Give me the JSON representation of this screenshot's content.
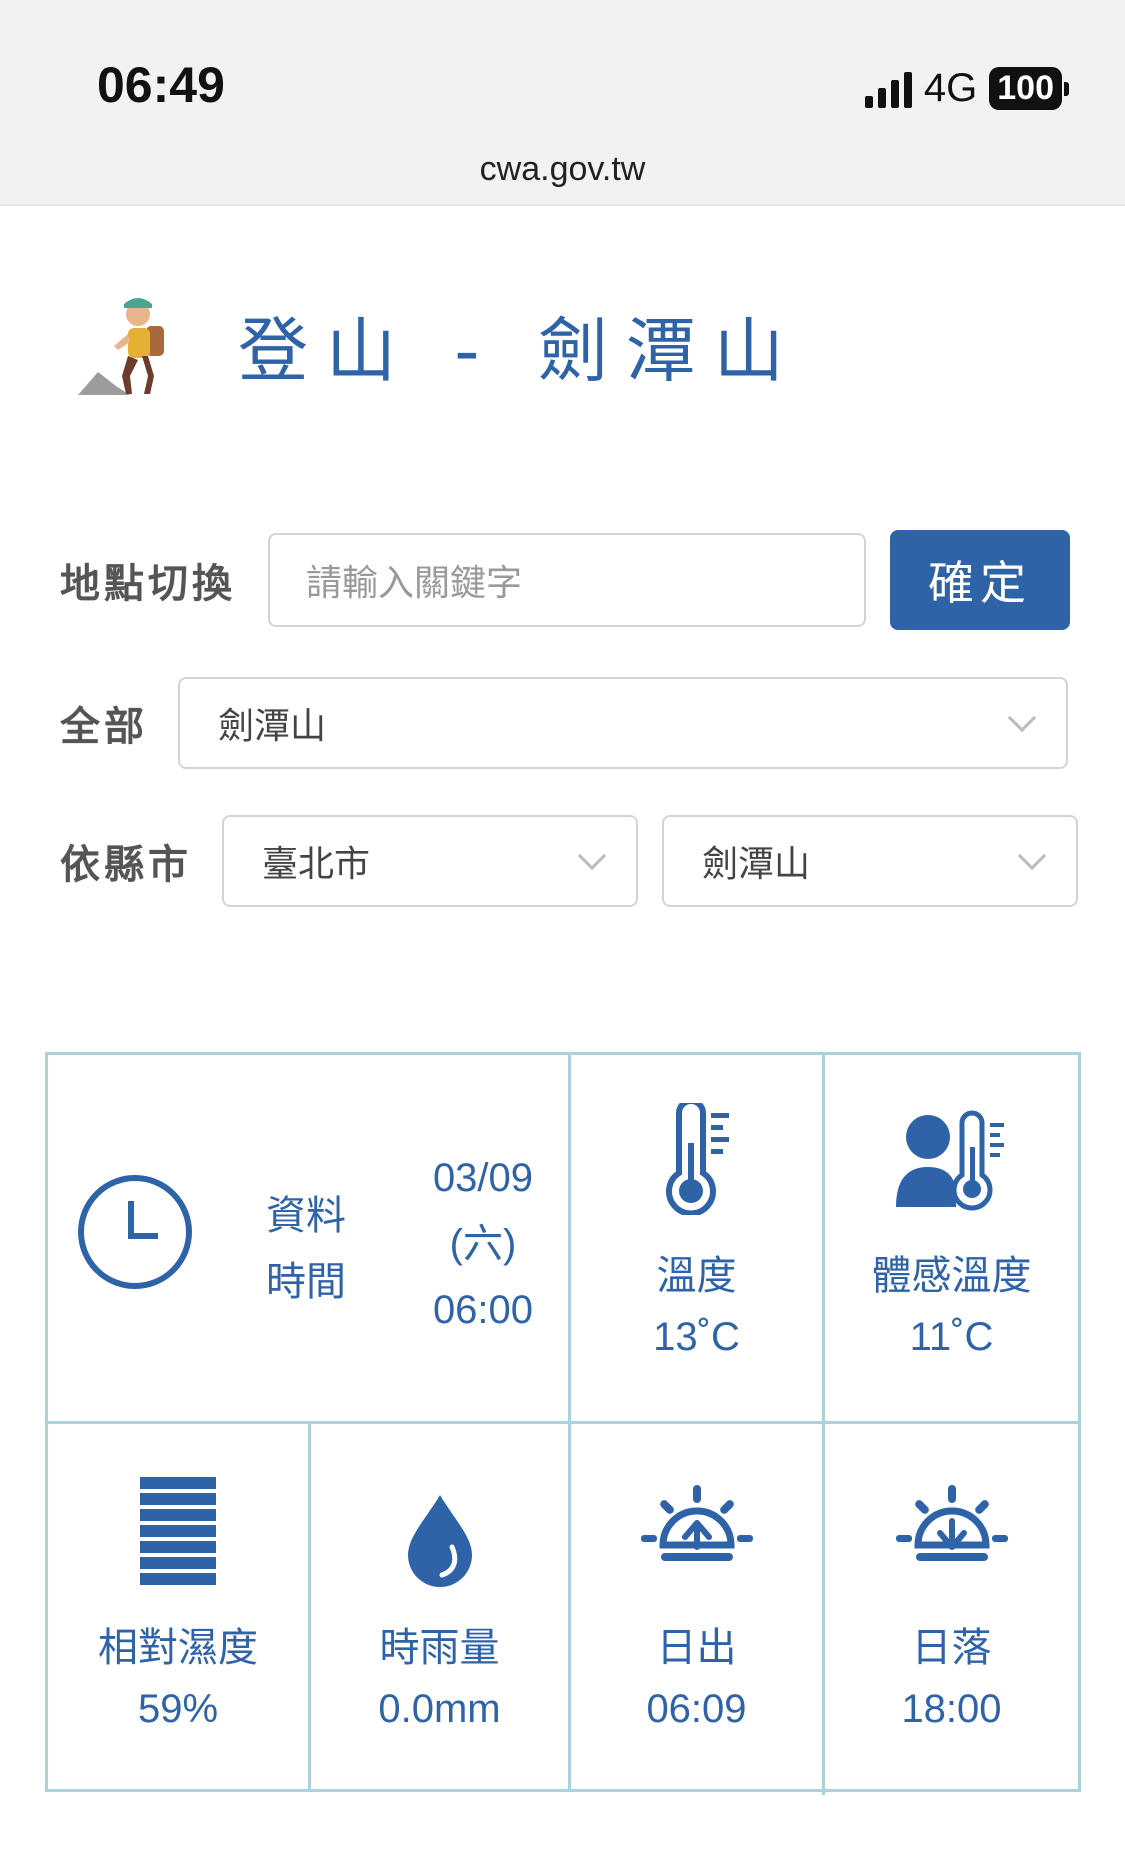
{
  "status_bar": {
    "time": "06:49",
    "network": "4G",
    "battery": "100"
  },
  "browser": {
    "url": "cwa.gov.tw"
  },
  "header": {
    "title": "登山 - 劍潭山"
  },
  "location_switch": {
    "label": "地點切換",
    "placeholder": "請輸入關鍵字",
    "confirm_label": "確定"
  },
  "all_filter": {
    "label": "全部",
    "selected": "劍潭山"
  },
  "county_filter": {
    "label": "依縣市",
    "county_selected": "臺北市",
    "location_selected": "劍潭山"
  },
  "weather": {
    "data_time_label_line1": "資料",
    "data_time_label_line2": "時間",
    "data_time_date": "03/09",
    "data_time_weekday": "(六)",
    "data_time_time": "06:00",
    "temperature": {
      "label": "溫度",
      "value": "13˚C"
    },
    "apparent_temperature": {
      "label": "體感溫度",
      "value": "11˚C"
    },
    "humidity": {
      "label": "相對濕度",
      "value": "59%"
    },
    "rainfall": {
      "label": "時雨量",
      "value": "0.0mm"
    },
    "sunrise": {
      "label": "日出",
      "value": "06:09"
    },
    "sunset": {
      "label": "日落",
      "value": "18:00"
    }
  },
  "colors": {
    "primary": "#2f63a8",
    "grid_border": "#a9d4de",
    "label_gray": "#555555"
  }
}
